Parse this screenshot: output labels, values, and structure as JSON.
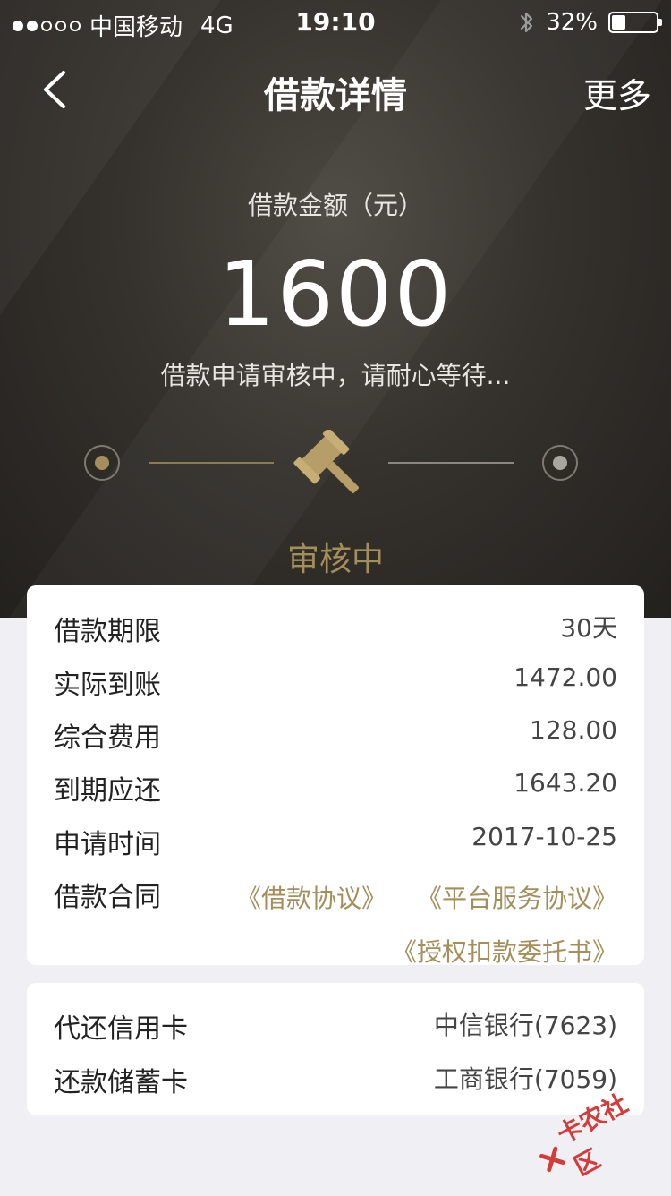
{
  "status_bar": {
    "carrier": "中国移动",
    "network": "4G",
    "time": "19:10",
    "battery_percent_label": "32%",
    "battery_level": 0.32
  },
  "nav": {
    "title": "借款详情",
    "more_label": "更多"
  },
  "summary": {
    "amount_label": "借款金额（元）",
    "amount": "1600",
    "status_message": "借款申请审核中，请耐心等待...",
    "stage_label": "审核中"
  },
  "details": {
    "rows": [
      {
        "label": "借款期限",
        "value": "30天"
      },
      {
        "label": "实际到账",
        "value": "1472.00"
      },
      {
        "label": "综合费用",
        "value": "128.00"
      },
      {
        "label": "到期应还",
        "value": "1643.20"
      },
      {
        "label": "申请时间",
        "value": "2017-10-25"
      }
    ],
    "contract_label": "借款合同",
    "contracts": [
      "《借款协议》",
      "《平台服务协议》",
      "《授权扣款委托书》"
    ]
  },
  "cards": {
    "rows": [
      {
        "label": "代还信用卡",
        "value": "中信银行(7623)"
      },
      {
        "label": "还款储蓄卡",
        "value": "工商银行(7059)"
      }
    ]
  },
  "watermark": {
    "text": "卡农社区"
  },
  "colors": {
    "accent_gold": "#a48e5b",
    "hero_dark": "#2b2925",
    "page_bg": "#efeff4"
  }
}
